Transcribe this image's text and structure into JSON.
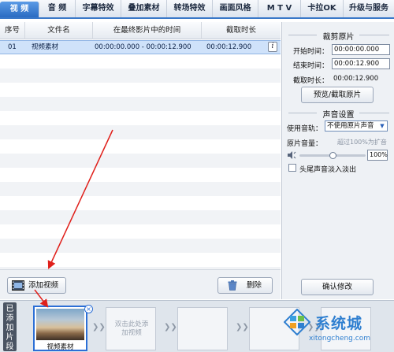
{
  "tabs": [
    {
      "label": "视  频",
      "active": true
    },
    {
      "label": "音  频",
      "active": false
    },
    {
      "label": "字幕特效",
      "active": false
    },
    {
      "label": "叠加素材",
      "active": false
    },
    {
      "label": "转场特效",
      "active": false
    },
    {
      "label": "画面风格",
      "active": false
    },
    {
      "label": "M T V",
      "active": false
    },
    {
      "label": "卡拉OK",
      "active": false
    },
    {
      "label": "升级与服务",
      "active": false
    }
  ],
  "table": {
    "headers": [
      "序号",
      "文件名",
      "在最终影片中的时间",
      "截取时长"
    ],
    "rows": [
      {
        "index": "01",
        "filename": "视频素材",
        "time": "00:00:00.000 - 00:00:12.900",
        "duration": "00:00:12.900",
        "info": "i"
      }
    ]
  },
  "buttons": {
    "add_video": "添加视频",
    "delete": "删除",
    "preview_crop": "预览/截取原片",
    "confirm": "确认修改"
  },
  "crop": {
    "title": "裁剪原片",
    "start_label": "开始时间：",
    "start_value": "00:00:00.000",
    "end_label": "结束时间：",
    "end_value": "00:00:12.900",
    "duration_label": "截取时长：",
    "duration_value": "00:00:12.900"
  },
  "audio": {
    "title": "声音设置",
    "track_label": "使用音轨：",
    "track_value": "不使用原片声音",
    "volume_label": "原片音量：",
    "volume_hint": "超过100%为扩音",
    "volume_value": "100%",
    "volume_level": 0.5,
    "fade_label": "头尾声音淡入淡出"
  },
  "strip": {
    "side_label": "已添加片段",
    "clip_label": "视频素材",
    "slot_hint": "双击此处添加视频"
  },
  "watermark": {
    "text": "系统城",
    "url": "xitongcheng.com"
  },
  "colors": {
    "accent": "#2a6bc2",
    "selected_row": "#cfe2fa",
    "annotation_arrow": "#e0201b"
  }
}
